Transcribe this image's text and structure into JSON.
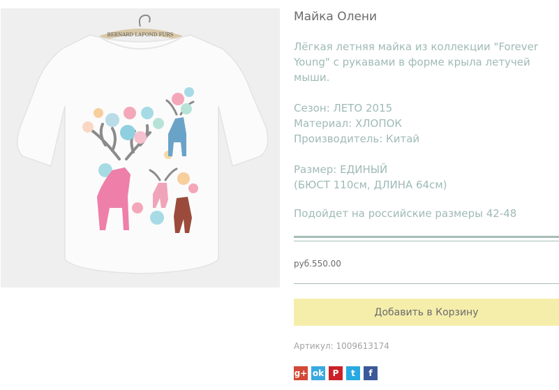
{
  "product": {
    "image_alt": "Майка Олени",
    "hanger_label": "BERNARD LAFOND FURS",
    "title": "Майка Олени",
    "description": "Лёгкая летняя майка из коллекции \"Forever Young\" с рукавами в форме крыла летучей мыши.",
    "specs": [
      "Сезон: ЛЕТО 2015",
      "Материал: ХЛОПОК",
      "Производитель: Китай"
    ],
    "size_lines": [
      "Размер: ЕДИНЫЙ",
      "(БЮСТ 110см, ДЛИНА 64см)"
    ],
    "fit_note": "Подойдет на российские размеры 42-48",
    "price": "руб.550.00",
    "add_to_cart_label": "Добавить в Корзину",
    "sku": "Артикул: 1009613174"
  },
  "social": [
    {
      "name": "google-plus-icon",
      "glyph": "g+",
      "color": "#d34836"
    },
    {
      "name": "odnoklassniki-icon",
      "glyph": "ok",
      "color": "#3aa9e0"
    },
    {
      "name": "pinterest-icon",
      "glyph": "P",
      "color": "#cb2027"
    },
    {
      "name": "twitter-icon",
      "glyph": "t",
      "color": "#29a9e1"
    },
    {
      "name": "facebook-icon",
      "glyph": "f",
      "color": "#3b5998"
    }
  ],
  "colors": {
    "accent_text": "#9fbab6",
    "rule": "#a6bdb9",
    "button_bg": "#f5eeab"
  }
}
